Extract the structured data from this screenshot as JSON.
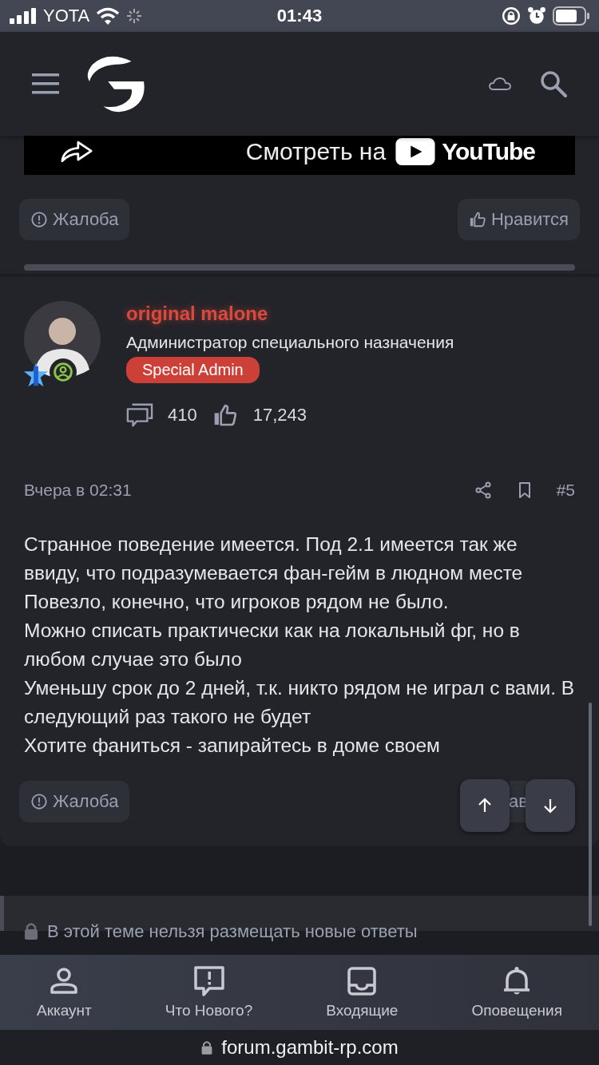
{
  "status_bar": {
    "carrier": "YOTA",
    "time": "01:43"
  },
  "video_embed": {
    "label": "Смотреть на",
    "logo_text": "YouTube"
  },
  "prev_post_actions": [
    {
      "kind": "report",
      "label": "Жалоба"
    },
    {
      "kind": "like",
      "label": "Нравится"
    }
  ],
  "post": {
    "author": "original malone",
    "user_title": "Администратор специального назначения",
    "badge": "Special Admin",
    "messages": "410",
    "reactions": "17,243",
    "date": "Вчера в 02:31",
    "number": "#5",
    "body": [
      "Странное поведение имеется. Под 2.1 имеется так же ввиду, что подразумевается фан-гейм в людном месте",
      "Повезло, конечно, что игроков рядом не было.",
      "Можно списать практически как на локальный фг, но в любом случае это было",
      "Уменьшу срок до 2 дней, т.к. никто рядом не играл с вами. В следующий раз такого не будет",
      "Хотите фаниться - запирайтесь в доме своем"
    ],
    "actions": [
      {
        "kind": "report",
        "label": "Жалоба"
      },
      {
        "kind": "like",
        "label": "ав"
      }
    ]
  },
  "lock_notice": "В этой теме нельзя размещать новые ответы",
  "tab_bar": [
    {
      "kind": "account",
      "label": "Аккаунт"
    },
    {
      "kind": "whats_new",
      "label": "Что Нового?"
    },
    {
      "kind": "inbox",
      "label": "Входящие"
    },
    {
      "kind": "alerts",
      "label": "Оповещения"
    }
  ],
  "url": "forum.gambit-rp.com"
}
